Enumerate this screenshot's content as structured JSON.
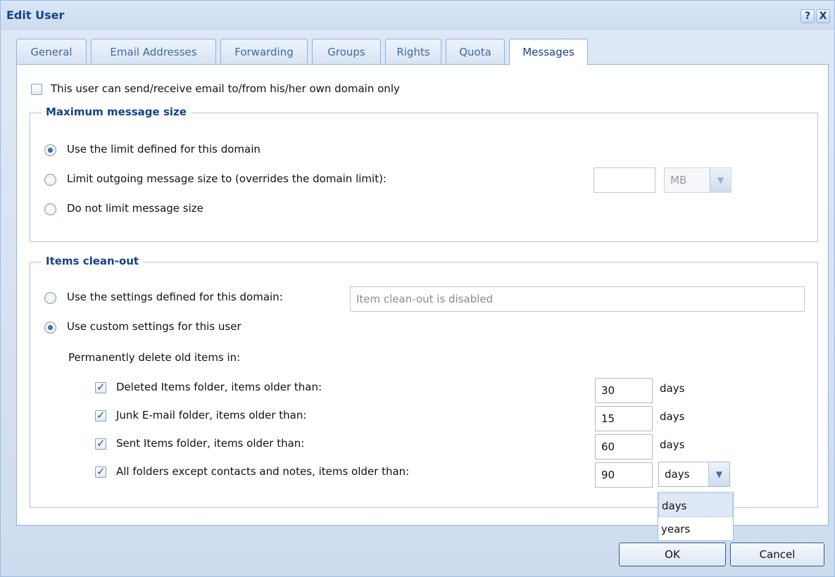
{
  "window": {
    "title": "Edit User",
    "help_label": "?",
    "close_label": "X"
  },
  "tabs": [
    {
      "label": "General"
    },
    {
      "label": "Email Addresses"
    },
    {
      "label": "Forwarding"
    },
    {
      "label": "Groups"
    },
    {
      "label": "Rights"
    },
    {
      "label": "Quota"
    },
    {
      "label": "Messages",
      "active": true
    }
  ],
  "own_domain_only": {
    "label": "This user can send/receive email to/from his/her own domain only",
    "checked": false
  },
  "max_message_size": {
    "legend": "Maximum message size",
    "options": [
      {
        "label": "Use the limit defined for this domain",
        "selected": true
      },
      {
        "label": "Limit outgoing message size to (overrides the domain limit):",
        "selected": false
      },
      {
        "label": "Do not limit message size",
        "selected": false
      }
    ],
    "size_value": "",
    "unit": "MB"
  },
  "items_cleanout": {
    "legend": "Items clean-out",
    "domain_option": {
      "label": "Use the settings defined for this domain:",
      "selected": false
    },
    "domain_value": "Item clean-out is disabled",
    "custom_option": {
      "label": "Use custom settings for this user",
      "selected": true
    },
    "delete_heading": "Permanently delete old items in:",
    "rules": [
      {
        "label": "Deleted Items folder, items older than:",
        "checked": true,
        "value": "30",
        "unit": "days"
      },
      {
        "label": "Junk E-mail folder, items older than:",
        "checked": true,
        "value": "15",
        "unit": "days"
      },
      {
        "label": "Sent Items folder, items older than:",
        "checked": true,
        "value": "60",
        "unit": "days"
      },
      {
        "label": "All folders except contacts and notes, items older than:",
        "checked": true,
        "value": "90",
        "unit": "days"
      }
    ],
    "unit_dropdown_options": [
      "days",
      "years"
    ]
  },
  "buttons": {
    "ok": "OK",
    "cancel": "Cancel"
  }
}
